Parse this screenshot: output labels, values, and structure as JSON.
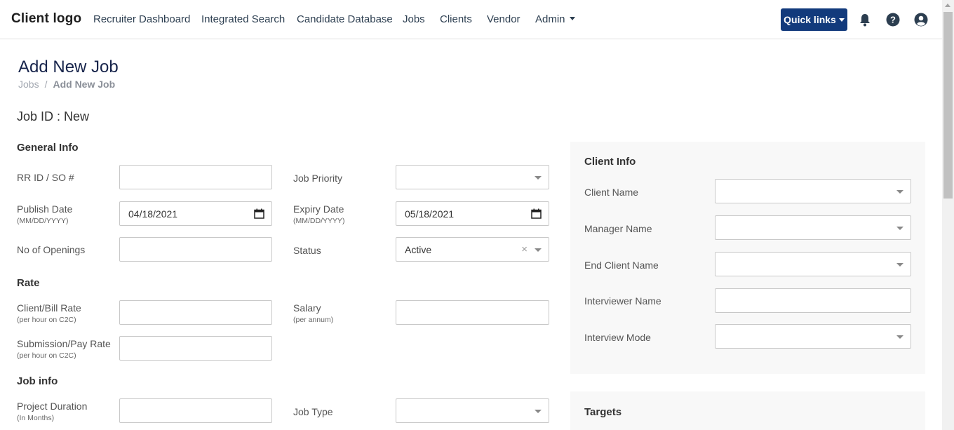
{
  "nav": {
    "logo": "Client logo",
    "links": [
      "Recruiter Dashboard",
      "Integrated Search",
      "Candidate Database",
      "Jobs",
      "Clients",
      "Vendor",
      "Admin"
    ],
    "quick_links": "Quick links"
  },
  "page": {
    "title": "Add New Job",
    "breadcrumb": [
      "Jobs",
      "/",
      "Add New Job"
    ],
    "job_id": "Job ID : New"
  },
  "sections": {
    "general": "General Info",
    "rate": "Rate",
    "jobinfo": "Job info",
    "client": "Client Info",
    "targets": "Targets"
  },
  "fields": {
    "rr_id": {
      "label": "RR ID / SO #",
      "value": ""
    },
    "job_priority": {
      "label": "Job Priority",
      "value": ""
    },
    "publish_date": {
      "label": "Publish Date",
      "sub": "(MM/DD/YYYY)",
      "value": "04/18/2021"
    },
    "expiry_date": {
      "label": "Expiry Date",
      "sub": "(MM/DD/YYYY)",
      "value": "05/18/2021"
    },
    "openings": {
      "label": "No of Openings",
      "value": ""
    },
    "status": {
      "label": "Status",
      "value": "Active"
    },
    "client_bill_rate": {
      "label": "Client/Bill Rate",
      "sub": "(per hour on C2C)",
      "value": ""
    },
    "salary": {
      "label": "Salary",
      "sub": "(per annum)",
      "value": ""
    },
    "submission_pay_rate": {
      "label": "Submission/Pay Rate",
      "sub": "(per hour on C2C)",
      "value": ""
    },
    "project_duration": {
      "label": "Project Duration",
      "sub": "(In Months)",
      "value": ""
    },
    "job_type": {
      "label": "Job Type",
      "value": ""
    },
    "client_name": {
      "label": "Client Name",
      "value": ""
    },
    "manager_name": {
      "label": "Manager Name",
      "value": ""
    },
    "end_client_name": {
      "label": "End Client Name",
      "value": ""
    },
    "interviewer_name": {
      "label": "Interviewer Name",
      "value": ""
    },
    "interview_mode": {
      "label": "Interview Mode",
      "value": ""
    }
  },
  "icons": {
    "bell": "bell-icon",
    "help": "help-icon",
    "user": "user-icon",
    "calendar": "calendar-icon",
    "clear": "×"
  },
  "colors": {
    "primary": "#123a7c",
    "title": "#17244b",
    "panel": "#f8f8f8"
  }
}
